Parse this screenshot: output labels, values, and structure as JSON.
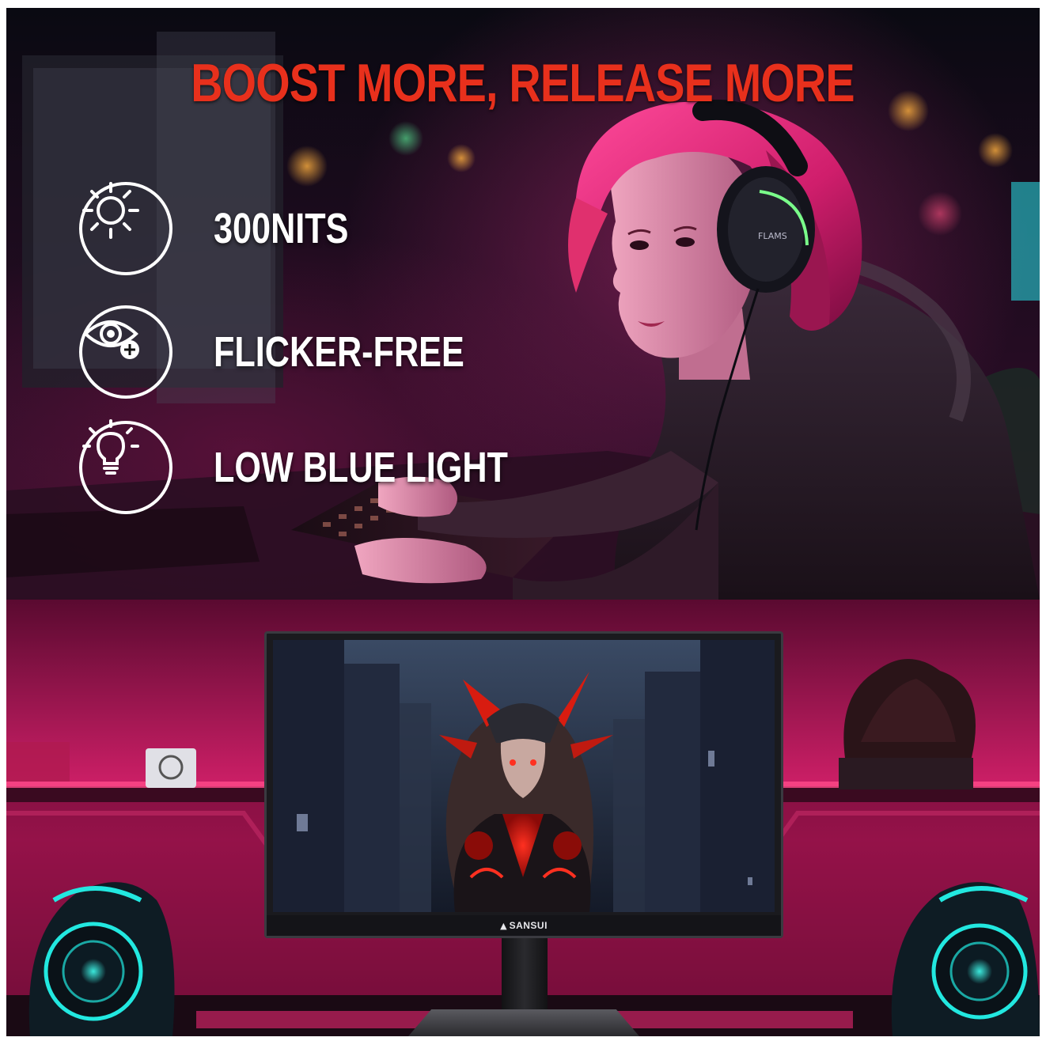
{
  "headline": "BOOST MORE, RELEASE MORE",
  "features": [
    {
      "icon": "sun-brightness-icon",
      "label": "300NITS"
    },
    {
      "icon": "eye-care-icon",
      "label": "FLICKER-FREE"
    },
    {
      "icon": "light-bulb-icon",
      "label": "LOW BLUE LIGHT"
    }
  ],
  "monitor": {
    "brand": "SANSUI"
  },
  "colors": {
    "headline": "#e8301c",
    "feature_text": "#ffffff",
    "neon_pink": "#ff2a7a",
    "neon_cyan": "#22e8e0"
  }
}
